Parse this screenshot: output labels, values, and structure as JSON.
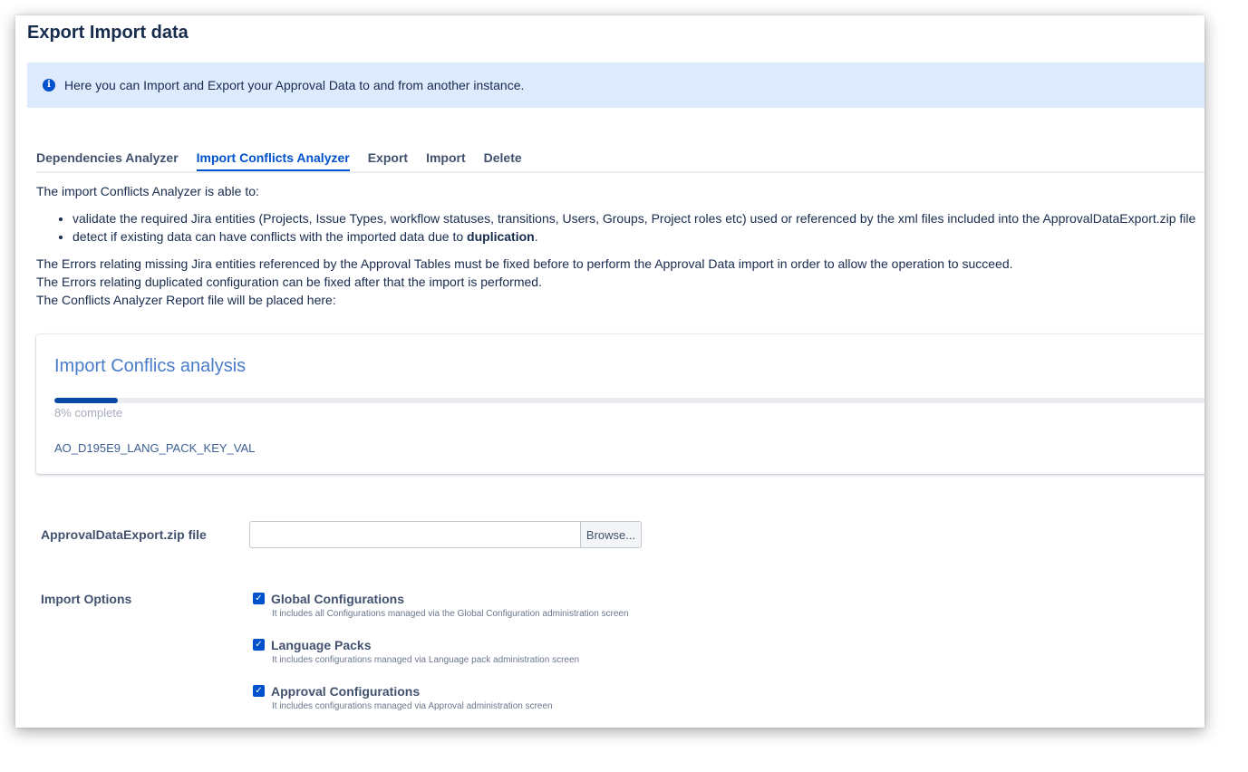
{
  "page": {
    "title": "Export Import data"
  },
  "banner": {
    "icon": "info-icon",
    "text": "Here you can Import and Export your Approval Data to and from another instance."
  },
  "tabs": [
    {
      "label": "Dependencies Analyzer",
      "active": false
    },
    {
      "label": "Import Conflicts Analyzer",
      "active": true
    },
    {
      "label": "Export",
      "active": false
    },
    {
      "label": "Import",
      "active": false
    },
    {
      "label": "Delete",
      "active": false
    }
  ],
  "description": {
    "intro": "The import Conflicts Analyzer is able to:",
    "bullet1": "validate the required Jira entities (Projects, Issue Types, workflow statuses, transitions, Users, Groups, Project roles etc) used or referenced by the xml files included into the ApprovalDataExport.zip file",
    "bullet2_prefix": "detect if existing data can have conflicts with the imported data due to ",
    "bullet2_bold": "duplication",
    "bullet2_suffix": ".",
    "line1": "The Errors relating missing Jira entities referenced by the Approval Tables must be fixed before to perform the Approval Data import in order to allow the operation to succeed.",
    "line2": "The Errors relating duplicated configuration can be fixed after that the import is performed.",
    "line3": "The Conflicts Analyzer Report file will be placed here:"
  },
  "analysis": {
    "title": "Import Conflics analysis",
    "progress_fraction": 0.054,
    "progress_text": "8% complete",
    "current_table": "AO_D195E9_LANG_PACK_KEY_VAL"
  },
  "file_upload": {
    "label": "ApprovalDataExport.zip file",
    "value": "",
    "browse_label": "Browse..."
  },
  "import_options": {
    "label": "Import Options",
    "items": [
      {
        "title": "Global Configurations",
        "description": "It includes all Configurations managed via the Global Configuration administration screen",
        "checked": true
      },
      {
        "title": "Language Packs",
        "description": "It includes configurations managed via Language pack administration screen",
        "checked": true
      },
      {
        "title": "Approval Configurations",
        "description": "It includes configurations managed via Approval administration screen",
        "checked": true
      }
    ]
  },
  "colors": {
    "accent": "#0052cc",
    "banner_bg": "#deebff",
    "panel_title": "#4a7cc9",
    "progress_fill": "#0747a6"
  }
}
